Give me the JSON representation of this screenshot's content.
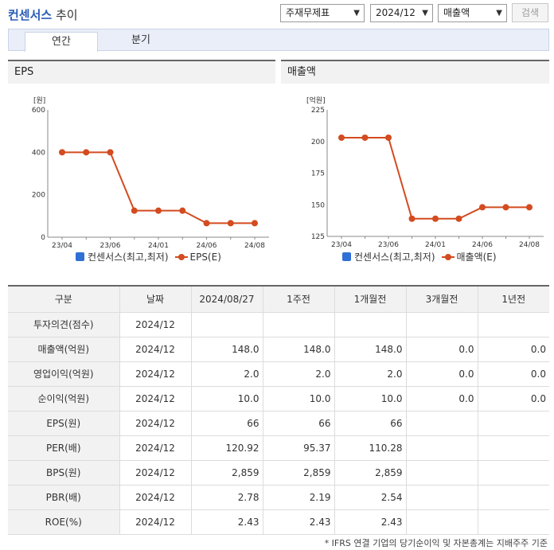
{
  "header": {
    "title_brand": "컨센서스",
    "title_rest": "추이",
    "select_type": "주재무제표",
    "select_period": "2024/12",
    "select_metric": "매출액",
    "search_label": "검색"
  },
  "tabs": [
    {
      "label": "연간",
      "active": true
    },
    {
      "label": "분기",
      "active": false
    }
  ],
  "charts": {
    "eps": {
      "panel_title": "EPS",
      "unit": "[원]",
      "yticks": [
        "0",
        "200",
        "400",
        "600"
      ],
      "xticks": [
        "23/04",
        "23/06",
        "24/01",
        "24/06",
        "24/08"
      ],
      "legend_bar": "컨센서스(최고,최저)",
      "legend_line": "EPS(E)"
    },
    "sales": {
      "panel_title": "매출액",
      "unit": "[억원]",
      "yticks": [
        "125",
        "150",
        "175",
        "200",
        "225"
      ],
      "xticks": [
        "23/04",
        "23/06",
        "24/01",
        "24/06",
        "24/08"
      ],
      "legend_bar": "컨센서스(최고,최저)",
      "legend_line": "매출액(E)"
    }
  },
  "chart_data": [
    {
      "type": "line",
      "title": "EPS",
      "ylabel": "[원]",
      "ylim": [
        0,
        600
      ],
      "x": [
        "23/04",
        "",
        "23/06",
        "",
        "24/01",
        "",
        "24/06",
        "",
        "24/08"
      ],
      "series": [
        {
          "name": "EPS(E)",
          "values": [
            400,
            400,
            400,
            125,
            125,
            125,
            66,
            66,
            66
          ]
        }
      ],
      "legend": [
        "컨센서스(최고,최저)",
        "EPS(E)"
      ],
      "color": "#d34b1f"
    },
    {
      "type": "line",
      "title": "매출액",
      "ylabel": "[억원]",
      "ylim": [
        125,
        225
      ],
      "x": [
        "23/04",
        "",
        "23/06",
        "",
        "24/01",
        "",
        "24/06",
        "",
        "24/08"
      ],
      "series": [
        {
          "name": "매출액(E)",
          "values": [
            203,
            203,
            203,
            139,
            139,
            139,
            148,
            148,
            148
          ]
        }
      ],
      "legend": [
        "컨센서스(최고,최저)",
        "매출액(E)"
      ],
      "color": "#d34b1f"
    }
  ],
  "table": {
    "headers": [
      "구분",
      "날짜",
      "2024/08/27",
      "1주전",
      "1개월전",
      "3개월전",
      "1년전"
    ],
    "rows": [
      [
        "투자의견(점수)",
        "2024/12",
        "",
        "",
        "",
        "",
        ""
      ],
      [
        "매출액(억원)",
        "2024/12",
        "148.0",
        "148.0",
        "148.0",
        "0.0",
        "0.0"
      ],
      [
        "영업이익(억원)",
        "2024/12",
        "2.0",
        "2.0",
        "2.0",
        "0.0",
        "0.0"
      ],
      [
        "순이익(억원)",
        "2024/12",
        "10.0",
        "10.0",
        "10.0",
        "0.0",
        "0.0"
      ],
      [
        "EPS(원)",
        "2024/12",
        "66",
        "66",
        "66",
        "",
        ""
      ],
      [
        "PER(배)",
        "2024/12",
        "120.92",
        "95.37",
        "110.28",
        "",
        ""
      ],
      [
        "BPS(원)",
        "2024/12",
        "2,859",
        "2,859",
        "2,859",
        "",
        ""
      ],
      [
        "PBR(배)",
        "2024/12",
        "2.78",
        "2.19",
        "2.54",
        "",
        ""
      ],
      [
        "ROE(%)",
        "2024/12",
        "2.43",
        "2.43",
        "2.43",
        "",
        ""
      ]
    ]
  },
  "footnote": "* IFRS 연결 기업의 당기순이익 및 자본총계는 지배주주 기준"
}
